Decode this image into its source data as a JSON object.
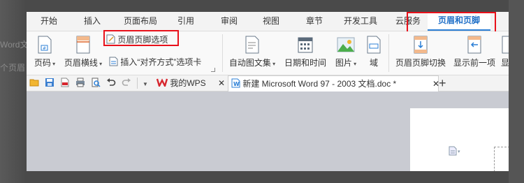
{
  "background": {
    "line1": "Word文",
    "line2": "个页眉"
  },
  "menu": {
    "items": [
      "开始",
      "插入",
      "页面布局",
      "引用",
      "审阅",
      "视图",
      "章节",
      "开发工具",
      "云服务",
      "页眉和页脚"
    ],
    "active_index": 9
  },
  "ribbon": {
    "options_label": "页眉页脚选项",
    "page_number": "页码",
    "header_line": "页眉横线",
    "insert_align_tab": "插入“对齐方式”选项卡",
    "auto_text": "自动图文集",
    "date_time": "日期和时间",
    "picture": "图片",
    "field": "域",
    "switch_header_footer": "页眉页脚切换",
    "show_previous": "显示前一项",
    "cut_label": "显"
  },
  "tabs": {
    "my_wps": "我的WPS",
    "document": "新建 Microsoft Word 97 - 2003 文档.doc *",
    "add": "+"
  },
  "colors": {
    "highlight": "#e8101a",
    "accent": "#2b7fd6",
    "wps_red": "#d7262e"
  }
}
